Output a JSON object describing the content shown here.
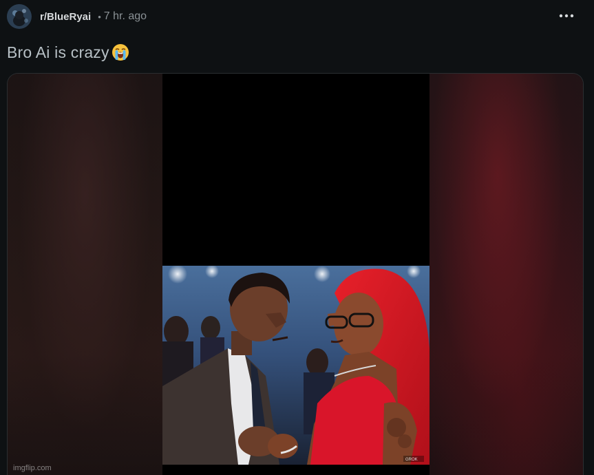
{
  "post": {
    "community": "r/BlueRyai",
    "separator": "•",
    "time": "7 hr. ago",
    "title": "Bro Ai is crazy",
    "title_emoji": "loudly-crying-face-icon",
    "more_icon": "more-options-icon"
  },
  "media": {
    "watermark": "imgflip.com",
    "photo_tag": "GROK"
  },
  "colors": {
    "background": "#0e1113",
    "community_text": "#d7dadc",
    "meta_text": "#8b9296",
    "title_text": "#b7c0c5"
  }
}
